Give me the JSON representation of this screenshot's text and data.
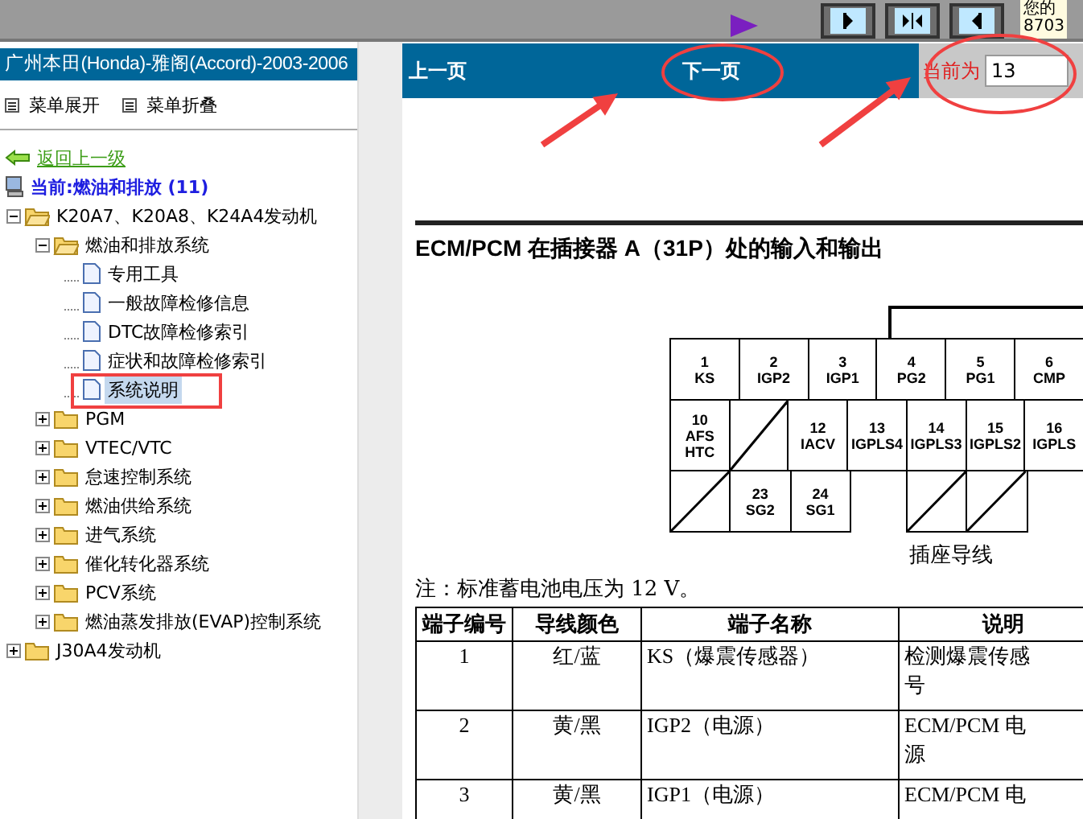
{
  "top_bar": {
    "user_info": [
      "您的",
      "8703"
    ]
  },
  "sidebar": {
    "title": "广州本田(Honda)-雅阁(Accord)-2003-2006",
    "menu_actions": [
      "菜单展开",
      "菜单折叠"
    ],
    "back_link": "返回上一级",
    "current": "当前:燃油和排放 (11)",
    "tree": [
      {
        "label": "K20A7、K20A8、K24A4发动机",
        "kind": "folder",
        "expanded": true,
        "selected": false,
        "children": [
          {
            "label": "燃油和排放系统",
            "kind": "folder",
            "expanded": true,
            "selected": false,
            "children": [
              {
                "label": "专用工具",
                "kind": "page",
                "selected": false
              },
              {
                "label": "一般故障检修信息",
                "kind": "page",
                "selected": false
              },
              {
                "label": "DTC故障检修索引",
                "kind": "page",
                "selected": false
              },
              {
                "label": "症状和故障检修索引",
                "kind": "page",
                "selected": false
              },
              {
                "label": "系统说明",
                "kind": "page",
                "selected": true
              }
            ]
          },
          {
            "label": "PGM",
            "kind": "folder",
            "expanded": false,
            "selected": false
          },
          {
            "label": "VTEC/VTC",
            "kind": "folder",
            "expanded": false,
            "selected": false
          },
          {
            "label": "怠速控制系统",
            "kind": "folder",
            "expanded": false,
            "selected": false
          },
          {
            "label": "燃油供给系统",
            "kind": "folder",
            "expanded": false,
            "selected": false
          },
          {
            "label": "进气系统",
            "kind": "folder",
            "expanded": false,
            "selected": false
          },
          {
            "label": "催化转化器系统",
            "kind": "folder",
            "expanded": false,
            "selected": false
          },
          {
            "label": "PCV系统",
            "kind": "folder",
            "expanded": false,
            "selected": false
          },
          {
            "label": "燃油蒸发排放(EVAP)控制系统",
            "kind": "folder",
            "expanded": false,
            "selected": false
          }
        ]
      },
      {
        "label": "J30A4发动机",
        "kind": "folder",
        "expanded": false,
        "selected": false
      }
    ]
  },
  "nav": {
    "prev": "上一页",
    "next": "下一页",
    "page_label": "当前为",
    "page_value": "13"
  },
  "document": {
    "heading": "ECM/PCM 在插接器 A（31P）处的输入和输出",
    "connector": [
      [
        {
          "kind": "pin",
          "number": "1",
          "label": "KS"
        },
        {
          "kind": "pin",
          "number": "2",
          "label": "IGP2"
        },
        {
          "kind": "pin",
          "number": "3",
          "label": "IGP1"
        },
        {
          "kind": "pin",
          "number": "4",
          "label": "PG2"
        },
        {
          "kind": "pin",
          "number": "5",
          "label": "PG1"
        },
        {
          "kind": "pin",
          "number": "6",
          "label": "CMP"
        }
      ],
      [
        {
          "kind": "pin",
          "number": "10",
          "label": "AFS HTC"
        },
        {
          "kind": "unused"
        },
        {
          "kind": "pin",
          "number": "12",
          "label": "IACV"
        },
        {
          "kind": "pin",
          "number": "13",
          "label": "IGPLS4"
        },
        {
          "kind": "pin",
          "number": "14",
          "label": "IGPLS3"
        },
        {
          "kind": "pin",
          "number": "15",
          "label": "IGPLS2"
        },
        {
          "kind": "pin",
          "number": "16",
          "label": "IGPLS"
        }
      ],
      [
        {
          "kind": "unused"
        },
        {
          "kind": "pin",
          "number": "23",
          "label": "SG2"
        },
        {
          "kind": "pin",
          "number": "24",
          "label": "SG1"
        },
        {
          "kind": "gap"
        },
        {
          "kind": "unused"
        },
        {
          "kind": "unused"
        },
        {
          "kind": "gap"
        }
      ]
    ],
    "caption": "插座导线",
    "note": "注：标准蓄电池电压为 12 V。",
    "table": {
      "columns": [
        "端子编号",
        "导线颜色",
        "端子名称",
        "说明"
      ],
      "rows": [
        [
          "1",
          "红/蓝",
          "KS（爆震传感器）",
          "检测爆震传感号"
        ],
        [
          "2",
          "黄/黑",
          "IGP2（电源）",
          "ECM/PCM 电源"
        ],
        [
          "3",
          "黄/黑",
          "IGP1（电源）",
          "ECM/PCM 电"
        ]
      ]
    }
  }
}
